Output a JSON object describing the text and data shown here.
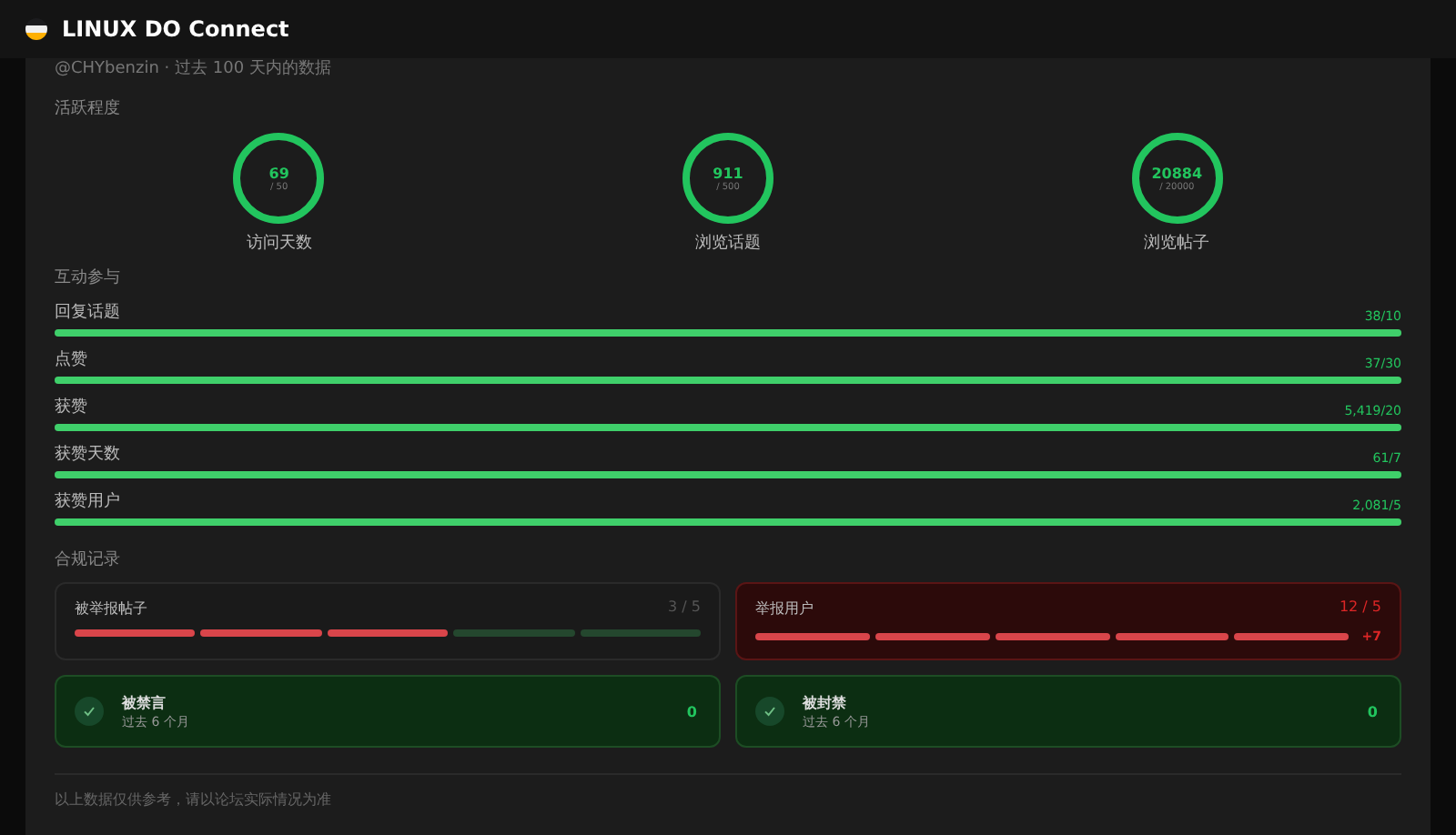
{
  "window": {
    "title": "LINUX DO Connect"
  },
  "subtitle": "@CHYbenzin · 过去 100 天内的数据",
  "activity": {
    "heading": "活跃程度",
    "rings": [
      {
        "value": "69",
        "target": "/ 50",
        "label": "访问天数",
        "level": 1
      },
      {
        "value": "911",
        "target": "/ 500",
        "label": "浏览话题",
        "level": 1
      },
      {
        "value": "20884",
        "target": "/ 20000",
        "label": "浏览帖子",
        "level": 1
      }
    ]
  },
  "interaction": {
    "heading": "互动参与",
    "rows": [
      {
        "label": "回复话题",
        "reading": "38/10",
        "level": 1
      },
      {
        "label": "点赞",
        "reading": "37/30",
        "level": 1
      },
      {
        "label": "获赞",
        "reading": "5,419/20",
        "level": 1
      },
      {
        "label": "获赞天数",
        "reading": "61/7",
        "level": 1
      },
      {
        "label": "获赞用户",
        "reading": "2,081/5",
        "level": 1
      }
    ]
  },
  "compliance": {
    "heading": "合规记录",
    "counters": [
      {
        "label": "被举报帖子",
        "count": "3 / 5",
        "alert": false,
        "segments": [
          {
            "filled": true
          },
          {
            "filled": true
          },
          {
            "filled": true
          },
          {
            "filled": false
          },
          {
            "filled": false
          }
        ]
      },
      {
        "label": "举报用户",
        "count": "12 / 5",
        "alert": true,
        "excess": "+7",
        "segments": [
          {
            "filled": true
          },
          {
            "filled": true
          },
          {
            "filled": true
          },
          {
            "filled": true
          },
          {
            "filled": true
          }
        ]
      }
    ],
    "records": [
      {
        "title": "被禁言",
        "period": "过去 6 个月",
        "count": "0",
        "clear": true
      },
      {
        "title": "被封禁",
        "period": "过去 6 个月",
        "count": "0",
        "clear": true
      }
    ]
  },
  "footer": "以上数据仅供参考，请以论坛实际情况为准"
}
